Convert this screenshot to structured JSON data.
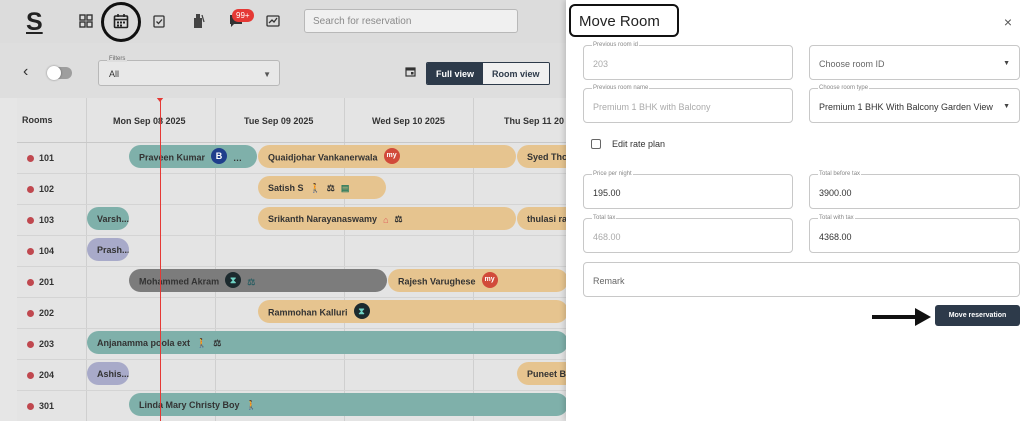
{
  "topbar": {
    "logo": "S",
    "badge": "99+",
    "search_placeholder": "Search for reservation"
  },
  "calendar": {
    "filter_label": "Filters",
    "filter_value": "All",
    "full_view": "Full view",
    "room_view": "Room view",
    "rooms_header": "Rooms",
    "days": [
      "Mon Sep 08 2025",
      "Tue Sep 09 2025",
      "Wed Sep 10 2025",
      "Thu Sep 11 20"
    ],
    "rooms": [
      "101",
      "102",
      "103",
      "104",
      "201",
      "202",
      "203",
      "204",
      "301"
    ],
    "reservations": [
      {
        "name": "Praveen Kumar",
        "extra": "…"
      },
      {
        "name": "Quaidjohar Vankanerwala"
      },
      {
        "name": "Syed Tho"
      },
      {
        "name": "Satish S"
      },
      {
        "name": "Varsh..."
      },
      {
        "name": "Srikanth Narayanaswamy"
      },
      {
        "name": "thulasi ra"
      },
      {
        "name": "Prash..."
      },
      {
        "name": "Mohammed Akram"
      },
      {
        "name": "Rajesh Varughese"
      },
      {
        "name": "Rammohan Kalluri"
      },
      {
        "name": "Anjanamma poola ext"
      },
      {
        "name": "Ashis..."
      },
      {
        "name": "Puneet Ba"
      },
      {
        "name": "Linda Mary Christy Boy"
      }
    ]
  },
  "modal": {
    "title": "Move Room",
    "close": "×",
    "prev_room_id_label": "Previous room id",
    "prev_room_id": "203",
    "choose_room_id_placeholder": "Choose room ID",
    "prev_room_name_label": "Previous room name",
    "prev_room_name": "Premium 1 BHK with Balcony",
    "choose_room_type_label": "Choose room type",
    "choose_room_type": "Premium 1 BHK With Balcony Garden View",
    "edit_rate_plan": "Edit rate plan",
    "price_per_night_label": "Price per night",
    "price_per_night": "195.00",
    "total_before_tax_label": "Total before tax",
    "total_before_tax": "3900.00",
    "total_tax_label": "Total tax",
    "total_tax": "468.00",
    "total_with_tax_label": "Total with tax",
    "total_with_tax": "4368.00",
    "remark_placeholder": "Remark",
    "move_button": "Move reservation"
  }
}
